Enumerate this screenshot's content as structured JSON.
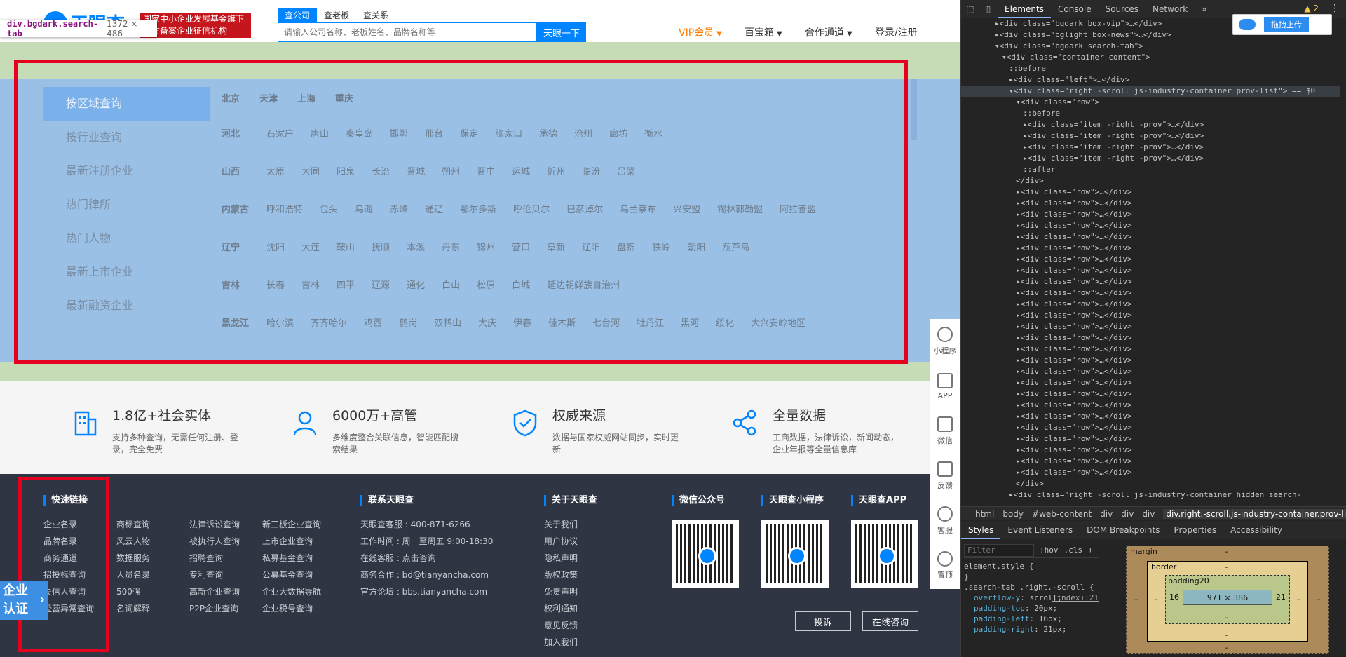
{
  "tooltip": {
    "selector": "div.bgdark.search-tab",
    "dims": "1372 × 486"
  },
  "header": {
    "logo_text": "天眼查",
    "banner_lines": [
      "国家中小企业发展基金旗下",
      "官方备案企业征信机构"
    ],
    "search_tabs": [
      "查公司",
      "查老板",
      "查关系"
    ],
    "search_placeholder": "请输入公司名称、老板姓名、品牌名称等",
    "search_button": "天眼一下",
    "nav": [
      "VIP会员",
      "百宝箱",
      "合作通道",
      "登录/注册"
    ]
  },
  "left_nav": [
    "按区域查询",
    "按行业查询",
    "最新注册企业",
    "热门律所",
    "热门人物",
    "最新上市企业",
    "最新融资企业"
  ],
  "municipalities": [
    "北京",
    "天津",
    "上海",
    "重庆"
  ],
  "provinces": [
    {
      "name": "河北",
      "cities": [
        "石家庄",
        "唐山",
        "秦皇岛",
        "邯郸",
        "邢台",
        "保定",
        "张家口",
        "承德",
        "沧州",
        "廊坊",
        "衡水"
      ]
    },
    {
      "name": "山西",
      "cities": [
        "太原",
        "大同",
        "阳泉",
        "长治",
        "晋城",
        "朔州",
        "晋中",
        "运城",
        "忻州",
        "临汾",
        "吕梁"
      ]
    },
    {
      "name": "内蒙古",
      "cities": [
        "呼和浩特",
        "包头",
        "乌海",
        "赤峰",
        "通辽",
        "鄂尔多斯",
        "呼伦贝尔",
        "巴彦淖尔",
        "乌兰察布",
        "兴安盟",
        "锡林郭勒盟",
        "阿拉善盟"
      ]
    },
    {
      "name": "辽宁",
      "cities": [
        "沈阳",
        "大连",
        "鞍山",
        "抚顺",
        "本溪",
        "丹东",
        "锦州",
        "营口",
        "阜新",
        "辽阳",
        "盘锦",
        "铁岭",
        "朝阳",
        "葫芦岛"
      ]
    },
    {
      "name": "吉林",
      "cities": [
        "长春",
        "吉林",
        "四平",
        "辽源",
        "通化",
        "白山",
        "松原",
        "白城",
        "延边朝鲜族自治州"
      ]
    },
    {
      "name": "黑龙江",
      "cities": [
        "哈尔滨",
        "齐齐哈尔",
        "鸡西",
        "鹤岗",
        "双鸭山",
        "大庆",
        "伊春",
        "佳木斯",
        "七台河",
        "牡丹江",
        "黑河",
        "绥化",
        "大兴安岭地区"
      ]
    }
  ],
  "features": [
    {
      "title": "1.8亿+社会实体",
      "desc": "支持多种查询，无需任何注册、登录，完全免费"
    },
    {
      "title": "6000万+高管",
      "desc": "多维度整合关联信息，智能匹配搜索结果"
    },
    {
      "title": "权威来源",
      "desc": "数据与国家权威网站同步，实时更新"
    },
    {
      "title": "全量数据",
      "desc": "工商数据，法律诉讼，新闻动态，企业年报等全量信息库"
    }
  ],
  "footer": {
    "quick_links_title": "快速链接",
    "quick_links": [
      [
        "企业名录",
        "品牌名录",
        "商务通道",
        "招投标查询",
        "失信人查询",
        "经营异常查询"
      ],
      [
        "商标查询",
        "风云人物",
        "数据服务",
        "人员名录",
        "500强",
        "名词解释"
      ],
      [
        "法律诉讼查询",
        "被执行人查询",
        "招聘查询",
        "专利查询",
        "高新企业查询",
        "P2P企业查询"
      ],
      [
        "新三板企业查询",
        "上市企业查询",
        "私募基金查询",
        "公募基金查询",
        "企业大数据导航",
        "企业税号查询"
      ]
    ],
    "contact_title": "联系天眼查",
    "contact": [
      "天眼查客服 : 400-871-6266",
      "工作时间 : 周一至周五 9:00-18:30",
      "在线客服 : 点击咨询",
      "商务合作 : bd@tianyancha.com",
      "官方论坛 : bbs.tianyancha.com"
    ],
    "about_title": "关于天眼查",
    "about": [
      "关于我们",
      "用户协议",
      "隐私声明",
      "版权政策",
      "免责声明",
      "权利通知",
      "意见反馈",
      "加入我们"
    ],
    "qr_titles": [
      "微信公众号",
      "天眼查小程序",
      "天眼查APP"
    ],
    "buttons": [
      "投诉",
      "在线咨询"
    ]
  },
  "sidebar": [
    "小程序",
    "APP",
    "微信",
    "反馈",
    "客服",
    "置顶"
  ],
  "badge": [
    "企业",
    "认证"
  ],
  "devtools": {
    "tabs": [
      "Elements",
      "Console",
      "Sources",
      "Network"
    ],
    "warning_count": "2",
    "upload_label": "拖拽上传",
    "dom_lines": [
      {
        "indent": 0,
        "text": "▸<div class=\"bgdark box-vip\">…</div>",
        "sel": false
      },
      {
        "indent": 0,
        "text": "▸<div class=\"bglight box-news\">…</div>",
        "sel": false
      },
      {
        "indent": 0,
        "text": "▾<div class=\"bgdark search-tab\">",
        "sel": false
      },
      {
        "indent": 1,
        "text": "▾<div class=\"container content\">",
        "sel": false
      },
      {
        "indent": 2,
        "text": "::before",
        "sel": false
      },
      {
        "indent": 2,
        "text": "▸<div class=\"left\">…</div>",
        "sel": false
      },
      {
        "indent": 2,
        "text": "▾<div class=\"right -scroll js-industry-container prov-list\"> == $0",
        "sel": true
      },
      {
        "indent": 3,
        "text": "▾<div class=\"row\">",
        "sel": false
      },
      {
        "indent": 4,
        "text": "::before",
        "sel": false
      },
      {
        "indent": 4,
        "text": "▸<div class=\"item -right -prov\">…</div>",
        "sel": false
      },
      {
        "indent": 4,
        "text": "▸<div class=\"item -right -prov\">…</div>",
        "sel": false
      },
      {
        "indent": 4,
        "text": "▸<div class=\"item -right -prov\">…</div>",
        "sel": false
      },
      {
        "indent": 4,
        "text": "▸<div class=\"item -right -prov\">…</div>",
        "sel": false
      },
      {
        "indent": 4,
        "text": "::after",
        "sel": false
      },
      {
        "indent": 3,
        "text": "</div>",
        "sel": false
      },
      {
        "indent": 3,
        "text": "▸<div class=\"row\">…</div>",
        "sel": false
      },
      {
        "indent": 3,
        "text": "▸<div class=\"row\">…</div>",
        "sel": false
      },
      {
        "indent": 3,
        "text": "▸<div class=\"row\">…</div>",
        "sel": false
      },
      {
        "indent": 3,
        "text": "▸<div class=\"row\">…</div>",
        "sel": false
      },
      {
        "indent": 3,
        "text": "▸<div class=\"row\">…</div>",
        "sel": false
      },
      {
        "indent": 3,
        "text": "▸<div class=\"row\">…</div>",
        "sel": false
      },
      {
        "indent": 3,
        "text": "▸<div class=\"row\">…</div>",
        "sel": false
      },
      {
        "indent": 3,
        "text": "▸<div class=\"row\">…</div>",
        "sel": false
      },
      {
        "indent": 3,
        "text": "▸<div class=\"row\">…</div>",
        "sel": false
      },
      {
        "indent": 3,
        "text": "▸<div class=\"row\">…</div>",
        "sel": false
      },
      {
        "indent": 3,
        "text": "▸<div class=\"row\">…</div>",
        "sel": false
      },
      {
        "indent": 3,
        "text": "▸<div class=\"row\">…</div>",
        "sel": false
      },
      {
        "indent": 3,
        "text": "▸<div class=\"row\">…</div>",
        "sel": false
      },
      {
        "indent": 3,
        "text": "▸<div class=\"row\">…</div>",
        "sel": false
      },
      {
        "indent": 3,
        "text": "▸<div class=\"row\">…</div>",
        "sel": false
      },
      {
        "indent": 3,
        "text": "▸<div class=\"row\">…</div>",
        "sel": false
      },
      {
        "indent": 3,
        "text": "▸<div class=\"row\">…</div>",
        "sel": false
      },
      {
        "indent": 3,
        "text": "▸<div class=\"row\">…</div>",
        "sel": false
      },
      {
        "indent": 3,
        "text": "▸<div class=\"row\">…</div>",
        "sel": false
      },
      {
        "indent": 3,
        "text": "▸<div class=\"row\">…</div>",
        "sel": false
      },
      {
        "indent": 3,
        "text": "▸<div class=\"row\">…</div>",
        "sel": false
      },
      {
        "indent": 3,
        "text": "▸<div class=\"row\">…</div>",
        "sel": false
      },
      {
        "indent": 3,
        "text": "▸<div class=\"row\">…</div>",
        "sel": false
      },
      {
        "indent": 3,
        "text": "▸<div class=\"row\">…</div>",
        "sel": false
      },
      {
        "indent": 3,
        "text": "▸<div class=\"row\">…</div>",
        "sel": false
      },
      {
        "indent": 3,
        "text": "▸<div class=\"row\">…</div>",
        "sel": false
      },
      {
        "indent": 3,
        "text": "</div>",
        "sel": false
      },
      {
        "indent": 2,
        "text": "▸<div class=\"right -scroll js-industry-container hidden search-",
        "sel": false
      }
    ],
    "breadcrumb": [
      "html",
      "body",
      "#web-content",
      "div",
      "div",
      "div",
      "div.right.-scroll.js-industry-container.prov-list"
    ],
    "subtabs": [
      "Styles",
      "Event Listeners",
      "DOM Breakpoints",
      "Properties",
      "Accessibility"
    ],
    "filter_placeholder": "Filter",
    "hov": ":hov",
    "cls": ".cls",
    "element_style": "element.style {",
    "rule_selector": ".search-tab .right.-scroll {",
    "rule_source": "(index):21",
    "rules": [
      {
        "prop": "overflow-y",
        "val": "scroll;"
      },
      {
        "prop": "padding-top",
        "val": "20px;"
      },
      {
        "prop": "padding-left",
        "val": "16px;"
      },
      {
        "prop": "padding-right",
        "val": "21px;"
      }
    ],
    "boxmodel": {
      "margin": "margin",
      "border": "border",
      "padding": "padding20",
      "content": "971 × 386",
      "left": "16",
      "right": "21",
      "dash": "–"
    }
  }
}
